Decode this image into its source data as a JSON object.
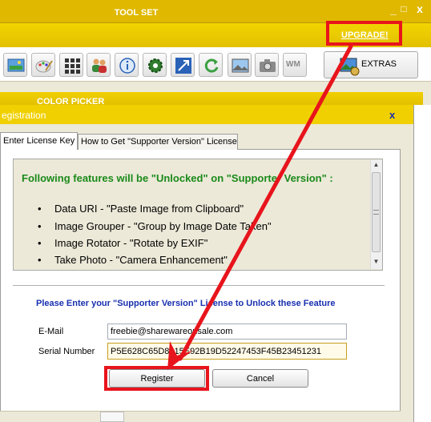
{
  "window": {
    "controls": {
      "minimize": "_",
      "maximize": "□",
      "close": "x"
    }
  },
  "toolset": {
    "label": "TOOL SET",
    "upgrade_link": "UPGRADE!",
    "tools": [
      "image-viewer-icon",
      "paint-palette-icon",
      "grid-icon",
      "users-icon",
      "info-icon",
      "gear-icon",
      "resize-icon",
      "rotate-icon",
      "landscape-image-icon",
      "camera-icon",
      "watermark-icon"
    ],
    "watermark_label": "WM",
    "extras_label": "EXTRAS"
  },
  "color_picker": {
    "label": "COLOR PICKER"
  },
  "dialog": {
    "title": "egistration",
    "close": "x",
    "tabs": [
      {
        "label": "Enter License Key",
        "active": true
      },
      {
        "label": "How to Get \"Supporter Version\" License",
        "active": false
      }
    ],
    "features_heading": "Following features will be \"Unlocked\" on \"Supporter Version\" :",
    "features": [
      "Data URI - \"Paste Image from Clipboard\"",
      "Image Grouper - \"Group by Image Date Taken\"",
      "Image Rotator - \"Rotate by EXIF\"",
      "Take Photo - \"Camera Enhancement\""
    ],
    "prompt": "Please Enter your \"Supporter Version\" License to Unlock these Feature",
    "email": {
      "label": "E-Mail",
      "value": "freebie@sharewareonsale.com"
    },
    "serial": {
      "label": "Serial Number",
      "value": "P5E628C65D8215E92B19D52247453F45B23451231"
    },
    "register_label": "Register",
    "cancel_label": "Cancel"
  },
  "colors": {
    "title_yellow": "#e0b800",
    "highlight_red": "#e8141c",
    "heading_green": "#1a8a1a",
    "prompt_blue": "#1830b0"
  }
}
